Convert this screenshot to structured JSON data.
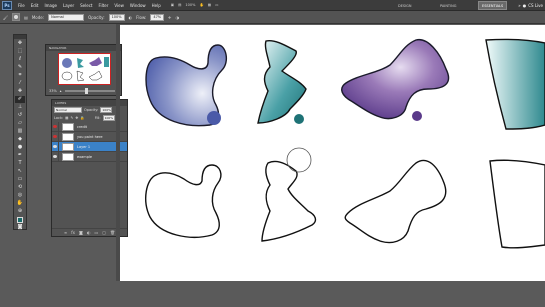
{
  "menubar": {
    "logo": "Ps",
    "items": [
      "File",
      "Edit",
      "Image",
      "Layer",
      "Select",
      "Filter",
      "View",
      "Window",
      "Help"
    ],
    "zoom": "100%",
    "workspaces": [
      "DESIGN",
      "PAINTING",
      "ESSENTIALS"
    ],
    "active_workspace": "PAINTING",
    "cslive": "CS Live"
  },
  "options": {
    "mode_label": "Mode:",
    "mode_value": "Normal",
    "opacity_label": "Opacity:",
    "opacity_value": "100%",
    "flow_label": "Flow:",
    "flow_value": "47%"
  },
  "navigator": {
    "title": "NAVIGATOR",
    "zoom": "33%"
  },
  "layers": {
    "title": "LAYERS",
    "blend_mode": "Normal",
    "opacity_label": "Opacity:",
    "opacity_value": "100%",
    "lock_label": "Lock:",
    "fill_label": "Fill:",
    "fill_value": "100%",
    "items": [
      {
        "name": "credit",
        "eye_color": "#cc3333",
        "selected": false
      },
      {
        "name": "you paint here",
        "eye_color": "#cc3333",
        "selected": false
      },
      {
        "name": "Layer 1",
        "eye_color": "#dddddd",
        "selected": true
      },
      {
        "name": "example",
        "eye_color": "#dddddd",
        "selected": false
      }
    ]
  },
  "colors": {
    "foreground": "#1a6a6a"
  }
}
